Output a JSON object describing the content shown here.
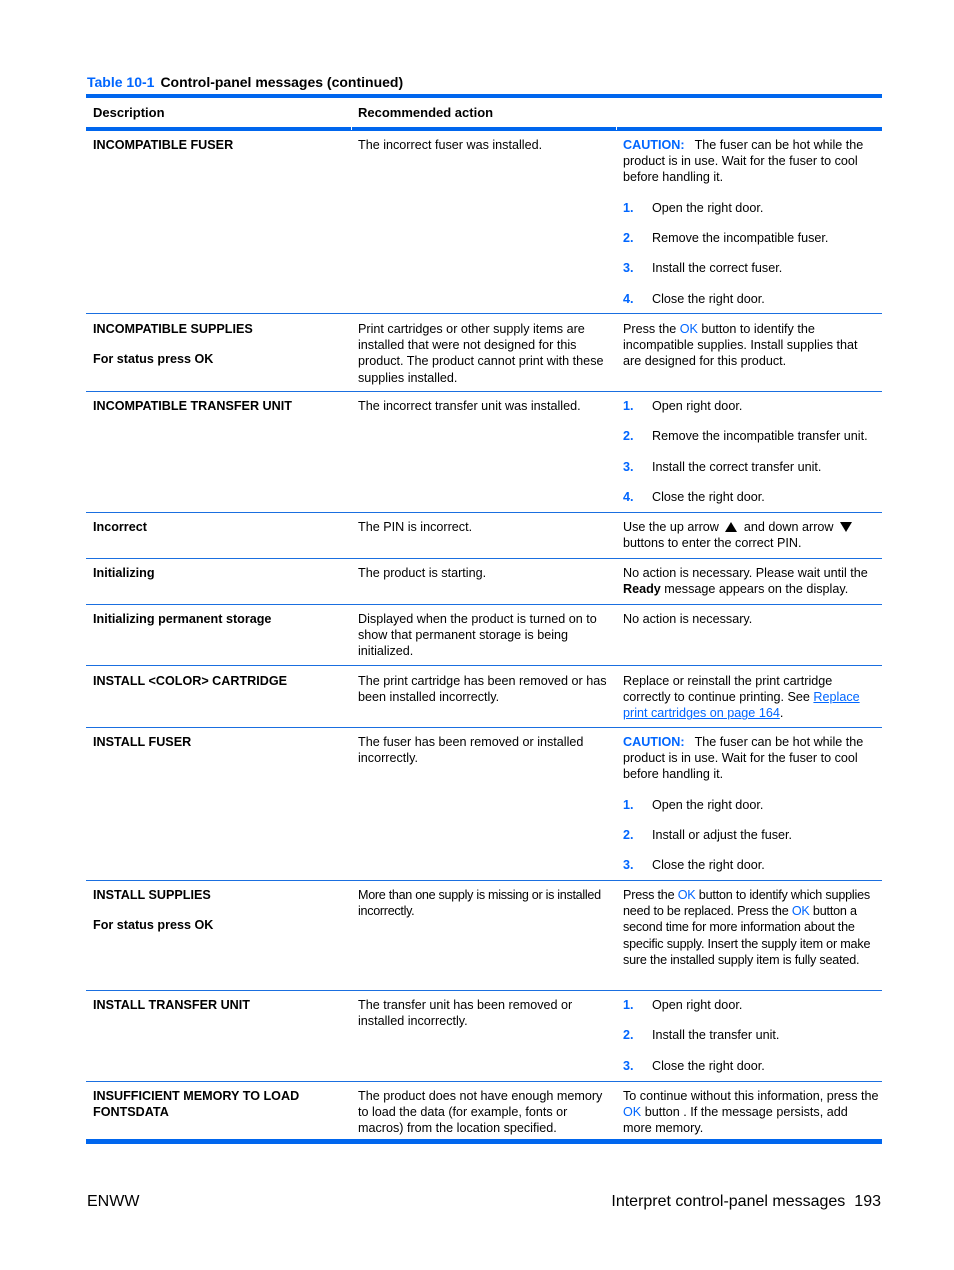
{
  "table": {
    "number": "Table 10-1",
    "title": "Control-panel messages (continued)",
    "headers": [
      "Description",
      "Recommended action"
    ],
    "accent_color": "#0066ff",
    "rows": [
      {
        "description": "INCOMPATIBLE FUSER",
        "cause": "The incorrect fuser was installed.",
        "caution_label": "CAUTION:",
        "caution_text": "The fuser can be hot while the product is in use. Wait for the fuser to cool before handling it.",
        "steps": [
          {
            "n": "1.",
            "text": "Open the right door."
          },
          {
            "n": "2.",
            "text": "Remove the incompatible fuser."
          },
          {
            "n": "3.",
            "text": "Install the correct fuser."
          },
          {
            "n": "4.",
            "text": "Close the right door."
          }
        ]
      },
      {
        "description": "INCOMPATIBLE SUPPLIES",
        "description_sub": "For status press OK",
        "cause": "Print cartridges or other supply items are installed that were not designed for this product. The product cannot print with these supplies installed.",
        "action_pre": "Press the ",
        "action_ok": "OK",
        "action_post": " button to identify the incompatible supplies. Install supplies that are designed for this product."
      },
      {
        "description": "INCOMPATIBLE TRANSFER UNIT",
        "cause": "The incorrect transfer unit was installed.",
        "steps": [
          {
            "n": "1.",
            "text": "Open right door."
          },
          {
            "n": "2.",
            "text": "Remove the incompatible transfer unit."
          },
          {
            "n": "3.",
            "text": "Install the correct transfer unit."
          },
          {
            "n": "4.",
            "text": "Close the right door."
          }
        ]
      },
      {
        "description": "Incorrect",
        "cause": "The PIN is incorrect.",
        "action_a": "Use the up arrow",
        "action_b": "and down arrow",
        "action_c": "buttons to enter the correct PIN.",
        "up_icon": "up-arrow-triangle",
        "down_icon": "down-arrow-triangle"
      },
      {
        "description": "Initializing",
        "cause": "The product is starting.",
        "action_pre": "No action is necessary. Please wait until the ",
        "action_bold": "Ready",
        "action_post": " message appears on the display."
      },
      {
        "description": "Initializing permanent storage",
        "cause": "Displayed when the product is turned on to show that permanent storage is being initialized.",
        "action": "No action is necessary."
      },
      {
        "description": "INSTALL <COLOR> CARTRIDGE",
        "cause": "The print cartridge has been removed or has been installed incorrectly.",
        "action_pre": "Replace or reinstall the print cartridge correctly to continue printing. See ",
        "action_link": "Replace print cartridges on page 164",
        "action_post": "."
      },
      {
        "description": "INSTALL FUSER",
        "cause": "The fuser has been removed or installed incorrectly.",
        "caution_label": "CAUTION:",
        "caution_text": "The fuser can be hot while the product is in use. Wait for the fuser to cool before handling it.",
        "steps": [
          {
            "n": "1.",
            "text": "Open the right door."
          },
          {
            "n": "2.",
            "text": "Install or adjust the fuser."
          },
          {
            "n": "3.",
            "text": "Close the right door."
          }
        ]
      },
      {
        "description": "INSTALL SUPPLIES",
        "description_sub": "For status press OK",
        "cause": "More than one supply is missing or is installed incorrectly.",
        "action_1": "Press the ",
        "action_ok1": "OK",
        "action_2": " button to identify which supplies need to be replaced. Press the ",
        "action_ok2": "OK",
        "action_3": " button a second time for more information about the specific supply. Insert the supply item or make sure the installed supply item is fully seated."
      },
      {
        "description": "INSTALL TRANSFER UNIT",
        "cause": "The transfer unit has been removed or installed incorrectly.",
        "steps": [
          {
            "n": "1.",
            "text": "Open right door."
          },
          {
            "n": "2.",
            "text": "Install the transfer unit."
          },
          {
            "n": "3.",
            "text": "Close the right door."
          }
        ]
      },
      {
        "description": "INSUFFICIENT MEMORY TO LOAD FONTSDATA",
        "cause": "The product does not have enough memory to load the data (for example, fonts or macros) from the location specified.",
        "action_pre": "To continue without this information, press the ",
        "action_ok": "OK",
        "action_post": " button . If the message persists, add more memory."
      }
    ]
  },
  "footer": {
    "left": "ENWW",
    "section": "Interpret control-panel messages",
    "page": "193"
  }
}
